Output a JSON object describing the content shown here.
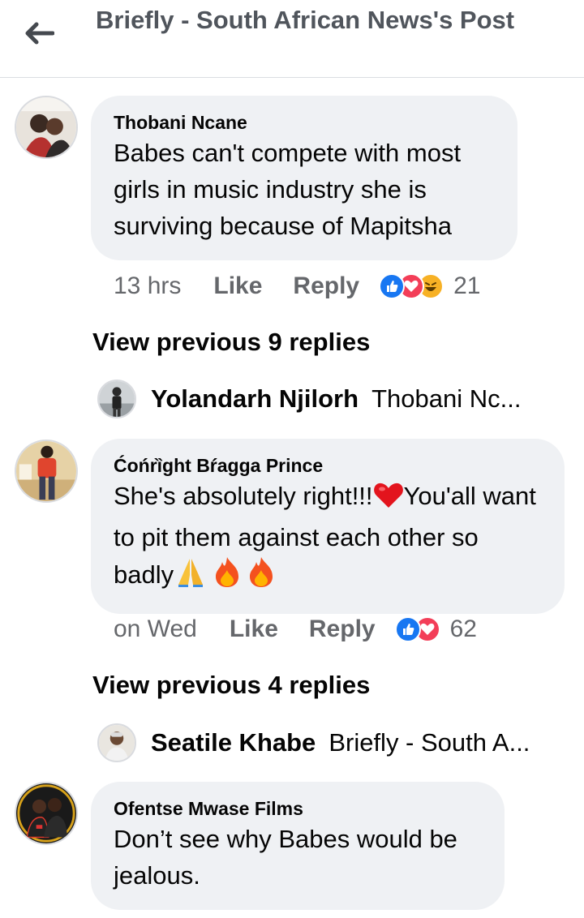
{
  "header": {
    "title": "Briefly - South African News's Post"
  },
  "comments": [
    {
      "author": "Thobani Ncane",
      "text": "Babes can't compete with most girls in music industry she is surviving because of Mapitsha",
      "time": "13 hrs",
      "like_label": "Like",
      "reply_label": "Reply",
      "reactions": [
        "like-icon",
        "love-icon",
        "haha-icon"
      ],
      "reaction_count": "21",
      "view_previous": "View previous 9 replies",
      "latest_reply": {
        "name": "Yolandarh Njilorh",
        "snippet": "Thobani Nc..."
      }
    },
    {
      "author": "Ćońrȉght Bŕagga Prince",
      "text_parts": [
        "She's absolutely right!!!",
        "You'all want to pit them against each other so badly"
      ],
      "time": "on Wed",
      "like_label": "Like",
      "reply_label": "Reply",
      "reactions": [
        "like-icon",
        "love-icon"
      ],
      "reaction_count": "62",
      "view_previous": "View previous 4 replies",
      "latest_reply": {
        "name": "Seatile Khabe",
        "snippet": "Briefly - South A..."
      }
    },
    {
      "author": "Ofentse Mwase Films",
      "text": "Don’t see why Babes would be jealous."
    }
  ],
  "colors": {
    "like": "#1877f2",
    "love": "#f33e58",
    "haha": "#f7b125",
    "bubble": "#eff1f4"
  }
}
